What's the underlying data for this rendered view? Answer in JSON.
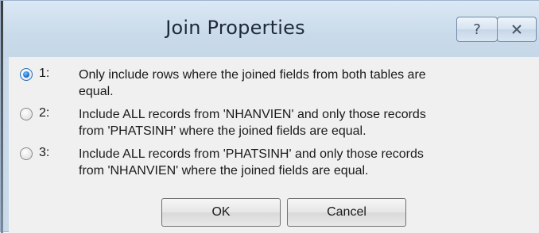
{
  "window": {
    "title": "Join Properties",
    "help_glyph": "?",
    "close_icon": "close-icon"
  },
  "options": [
    {
      "number": "1:",
      "text": "Only include rows where the joined fields from both tables are\nequal.",
      "checked": true
    },
    {
      "number": "2:",
      "text": "Include ALL records from 'NHANVIEN' and only those records\nfrom 'PHATSINH' where the joined fields are equal.",
      "checked": false
    },
    {
      "number": "3:",
      "text": "Include ALL records from 'PHATSINH' and only those records\nfrom 'NHANVIEN' where the joined fields are equal.",
      "checked": false
    }
  ],
  "buttons": {
    "ok": "OK",
    "cancel": "Cancel"
  },
  "colors": {
    "titlebar": "#c9daea",
    "client": "#f0f0f0",
    "radio_accent": "#1f6fc7"
  }
}
